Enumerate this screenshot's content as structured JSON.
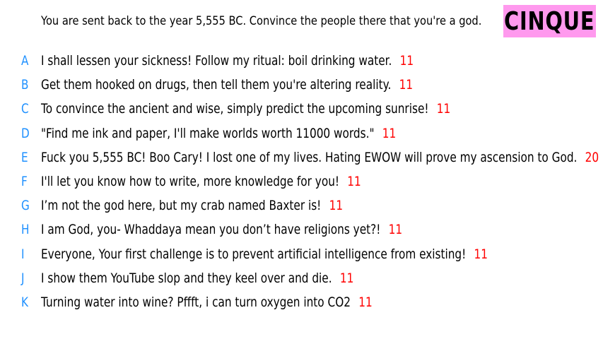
{
  "prompt": "You are sent back to the year 5,555 BC. Convince the people there that you're a god.",
  "badge": {
    "label": "CINQUE",
    "color": "#ff99ee"
  },
  "colors": {
    "letter": "#1e90ff",
    "score": "#ff0000",
    "text": "#000000"
  },
  "entries": [
    {
      "letter": "A",
      "text": "I shall lessen your sickness! Follow my ritual: boil drinking water.",
      "score": "11"
    },
    {
      "letter": "B",
      "text": "Get them hooked on drugs, then tell them you're altering reality.",
      "score": "11"
    },
    {
      "letter": "C",
      "text": "To convince the ancient and wise, simply predict the upcoming sunrise!",
      "score": "11"
    },
    {
      "letter": "D",
      "text": "\"Find me ink and paper, I'll make worlds worth 11000 words.\"",
      "score": "11"
    },
    {
      "letter": "E",
      "text": "Fuck you 5,555 BC! Boo Cary! I lost one of my lives. Hating EWOW will prove my ascension to God.",
      "score": "20"
    },
    {
      "letter": "F",
      "text": "I'll let you know how to write, more knowledge for you!",
      "score": "11"
    },
    {
      "letter": "G",
      "text": "I’m not the god here, but my crab named Baxter is!",
      "score": "11"
    },
    {
      "letter": "H",
      "text": "I am God, you- Whaddaya mean you don’t have religions yet?!",
      "score": "11"
    },
    {
      "letter": "I",
      "text": "Everyone, Your first challenge is to prevent artificial intelligence from existing!",
      "score": "11"
    },
    {
      "letter": "J",
      "text": "I show them YouTube slop and they keel over and die.",
      "score": "11"
    },
    {
      "letter": "K",
      "text": "Turning water into wine? Pffft, i can turn oxygen into CO2",
      "score": "11"
    }
  ]
}
